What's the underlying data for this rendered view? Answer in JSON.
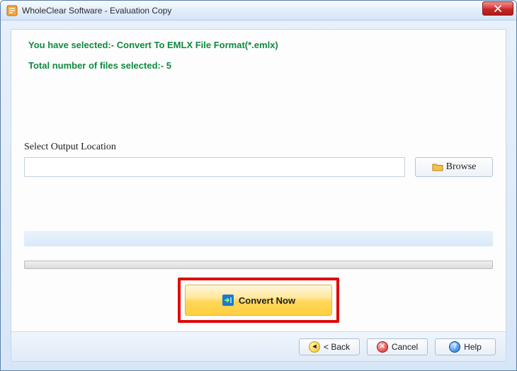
{
  "window": {
    "title": "WholeClear Software - Evaluation Copy"
  },
  "info": {
    "selected_format": "You have selected:- Convert To EMLX File Format(*.emlx)",
    "file_count": "Total number of files selected:- 5"
  },
  "output": {
    "label": "Select Output Location",
    "path_value": "",
    "browse_label": "Browse"
  },
  "convert": {
    "label": "Convert Now"
  },
  "footer": {
    "back": "< Back",
    "cancel": "Cancel",
    "help": "Help"
  }
}
